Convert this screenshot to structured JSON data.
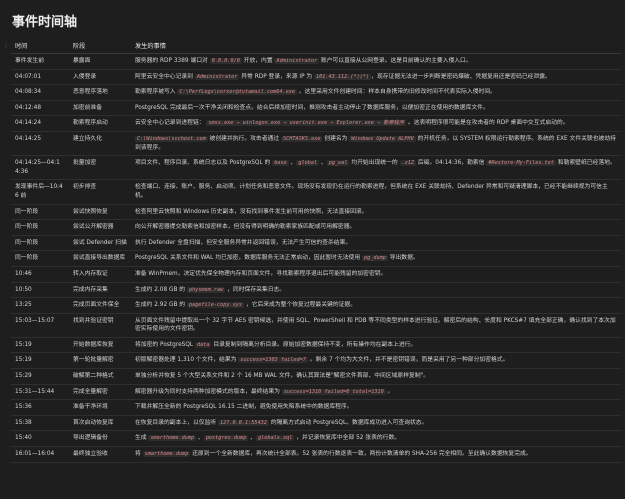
{
  "page": {
    "title": "事件时间轴"
  },
  "table": {
    "headers": [
      "时间",
      "阶段",
      "发生的事情"
    ],
    "rows": [
      {
        "time": "事件发生前",
        "phase": "暴露面",
        "desc": [
          [
            "t",
            "服务器的 RDP 3389 端口对 "
          ],
          [
            "c",
            "0.0.0.0/0"
          ],
          [
            "t",
            " 开放，内置 "
          ],
          [
            "c",
            "Administrator"
          ],
          [
            "t",
            " 账户可以直接从公网登录。这是目前确认的主要入侵入口。"
          ]
        ]
      },
      {
        "time": "04:07:01",
        "phase": "入侵登录",
        "desc": [
          [
            "t",
            "阿里云安全中心记录到 "
          ],
          [
            "c",
            "Administrator"
          ],
          [
            "t",
            " 异常 RDP 登录，来源 IP 为 "
          ],
          [
            "c",
            "101.43.112.(*)(*)"
          ],
          [
            "t",
            "，现存证据无法进一步判断是密码爆破、凭据复用还是密码已经泄露。"
          ]
        ]
      },
      {
        "time": "04:08:34",
        "phase": "恶意程序落地",
        "desc": [
          [
            "t",
            "勒索程序被写入 "
          ],
          [
            "c",
            "C:\\PerfLogs\\corxor@tutamail.com64.exe"
          ],
          [
            "t",
            " 。这里采用文件创建时间：样本自身携带的旧修改时间不代表实际入侵时间。"
          ]
        ]
      },
      {
        "time": "04:12:48",
        "phase": "加密前准备",
        "desc": [
          [
            "t",
            "PostgreSQL 完成最后一次干净关闭和检查点。结合后续加密时间，推测攻击者主动停止了数据库服务，以便加密正在使用的数据库文件。"
          ]
        ]
      },
      {
        "time": "04:14:24",
        "phase": "勒索程序启动",
        "desc": [
          [
            "t",
            "云安全中心记录到进程链： "
          ],
          [
            "c",
            "smss.exe → winlogon.exe → userinit.exe → Explorer.exe → 勒索程序"
          ],
          [
            "t",
            " 。这表明程序很可能是在攻击者的 RDP 桌面中交互式启动的。"
          ]
        ]
      },
      {
        "time": "04:14:25",
        "phase": "建立持久化",
        "desc": [
          [
            "c",
            "C:\\Windows\\svchost.com"
          ],
          [
            "t",
            " 被创建并执行。攻击者通过 "
          ],
          [
            "c",
            "SCHTASKS.exe"
          ],
          [
            "t",
            " 创建名为 "
          ],
          [
            "c",
            "Windows Update ALPHV"
          ],
          [
            "t",
            " 的开机任务，以 SYSTEM 权限运行勒索程序。系统的 EXE 文件关联也被劫持到该程序。"
          ]
        ]
      },
      {
        "time": "04:14:25—04:14:36",
        "phase": "批量加密",
        "desc": [
          [
            "t",
            "项目文件、程序目录、系统日志以及 PostgreSQL 的 "
          ],
          [
            "c",
            "base"
          ],
          [
            "t",
            " 、"
          ],
          [
            "c",
            "global"
          ],
          [
            "t",
            " 、"
          ],
          [
            "c",
            "pg_wal"
          ],
          [
            "t",
            " 均开始出现统一的 "
          ],
          [
            "c",
            ".z1Z"
          ],
          [
            "t",
            " 后缀。04:14:36，勒索信 "
          ],
          [
            "c",
            "#Restore-My-Files.txt"
          ],
          [
            "t",
            " 和勒索壁纸已经落地。"
          ]
        ]
      },
      {
        "time": "发现事件后—10:46 前",
        "phase": "初步排查",
        "desc": [
          [
            "t",
            "检查端口、连接、账户、服务、启动项、计划任务和恶意文件。现场没有发现仍在运行的勒索进程，但系统在 EXE 关联劫持、Defender 异常和可疑清理脚本，已经不能继续视为可信主机。"
          ]
        ]
      },
      {
        "time": "同一阶段",
        "phase": "尝试快照恢复",
        "desc": [
          [
            "t",
            "检查阿里云快照和 Windows 历史副本，没有找到事件发生前可用的快照，无法直接回滚。"
          ]
        ]
      },
      {
        "time": "同一阶段",
        "phase": "尝试公开解密器",
        "desc": [
          [
            "t",
            "向公开解密器提交勒索信和加密样本，但没有得到明确的勒索家族匹配或可用解密器。"
          ]
        ]
      },
      {
        "time": "同一阶段",
        "phase": "尝试 Defender 扫描",
        "desc": [
          [
            "t",
            "执行 Defender 全盘扫描，但安全服务异常并返回错误，无法产生可信的查杀结果。"
          ]
        ]
      },
      {
        "time": "同一阶段",
        "phase": "尝试直接导出数据库",
        "desc": [
          [
            "t",
            "PostgreSQL 关系文件和 WAL 均已加密，数据库服务无法正常启动，因此暂时无法使用 "
          ],
          [
            "c",
            "pg_dump"
          ],
          [
            "t",
            " 导出数据。"
          ]
        ]
      },
      {
        "time": "10:46",
        "phase": "转入内存取证",
        "desc": [
          [
            "t",
            "准备 WinPmem，决定优先保全物理内存和页面文件，寻找勒索程序退出后可能残留的加密密钥。"
          ]
        ]
      },
      {
        "time": "10:50",
        "phase": "完成内存采集",
        "desc": [
          [
            "t",
            "生成约 2.08 GB 的 "
          ],
          [
            "c",
            "physmem.raw"
          ],
          [
            "t",
            " ，同时保存采集日志。"
          ]
        ]
      },
      {
        "time": "13:25",
        "phase": "完成页面文件保全",
        "desc": [
          [
            "t",
            "生成约 2.92 GB 的 "
          ],
          [
            "c",
            "pagefile-copy.sys"
          ],
          [
            "t",
            " ，它后来成为整个恢复过程最关键的证据。"
          ]
        ]
      },
      {
        "time": "15:03—15:07",
        "phase": "找到并验证密钥",
        "desc": [
          [
            "t",
            "从页面文件残留中提取出一个 32 字节 AES 密钥候选，并使用 SQL、PowerShell 和 PDB 等不同类型的样本进行验证。解密后的结构、长度和 PKCS#7 填充全部正确，确认找到了本次加密实际使用的文件密钥。"
          ]
        ]
      },
      {
        "time": "15:19",
        "phase": "开始数据库恢复",
        "desc": [
          [
            "t",
            "将加密的 PostgreSQL "
          ],
          [
            "c",
            "data"
          ],
          [
            "t",
            " 目录复制到隔离分析目录。原始加密数据保持不变，所有操作均在副本上进行。"
          ]
        ]
      },
      {
        "time": "15:19",
        "phase": "第一轮批量解密",
        "desc": [
          [
            "t",
            "初版解密器处理 1,310 个文件，结果为 "
          ],
          [
            "c",
            "success=1303 failed=7"
          ],
          [
            "t",
            " 。剩余 7 个均为大文件，并不是密钥错误，而是采用了另一种部分加密格式。"
          ]
        ]
      },
      {
        "time": "15:29",
        "phase": "破解第二种格式",
        "desc": [
          [
            "t",
            "单独分析并恢复 5 个大型关系文件和 2 个 16 MB WAL 文件，确认其算法是\"解密文件首部、中间区域原样复制\"。"
          ]
        ]
      },
      {
        "time": "15:31—15:44",
        "phase": "完成全量解密",
        "desc": [
          [
            "t",
            "解密器升级为同时支持两种加密模式的版本，最终结果为 "
          ],
          [
            "c",
            "success=1310 failed=0 total=1310"
          ],
          [
            "t",
            " 。"
          ]
        ]
      },
      {
        "time": "15:36",
        "phase": "准备干净环境",
        "desc": [
          [
            "t",
            "下载并解压全新的 PostgreSQL 16.15 二进制，避免使用失陷系统中的数据库程序。"
          ]
        ]
      },
      {
        "time": "15:38",
        "phase": "首次启动恢复库",
        "desc": [
          [
            "t",
            "在恢复目录的副本上，以仅监听 "
          ],
          [
            "c",
            "127.0.0.1:55432"
          ],
          [
            "t",
            " 的隔离方式启动 PostgreSQL。数据库成功进入可查询状态。"
          ]
        ]
      },
      {
        "time": "15:40",
        "phase": "导出逻辑备份",
        "desc": [
          [
            "t",
            "生成 "
          ],
          [
            "c",
            "smarthome.dump"
          ],
          [
            "t",
            " 、"
          ],
          [
            "c",
            "postgres.dump"
          ],
          [
            "t",
            " 、"
          ],
          [
            "c",
            "globals.sql"
          ],
          [
            "t",
            " ，并记录恢复库中全部 52 张表的行数。"
          ]
        ]
      },
      {
        "time": "16:01—16:04",
        "phase": "最终独立验收",
        "desc": [
          [
            "t",
            "将 "
          ],
          [
            "c",
            "smarthome.dump"
          ],
          [
            "t",
            " 还原到一个全新数据库，再次统计全部表。52 张表的行数逐表一致，两份计数清单的 SHA-256 完全相同。至此确认数据恢复完成。"
          ]
        ]
      }
    ]
  }
}
